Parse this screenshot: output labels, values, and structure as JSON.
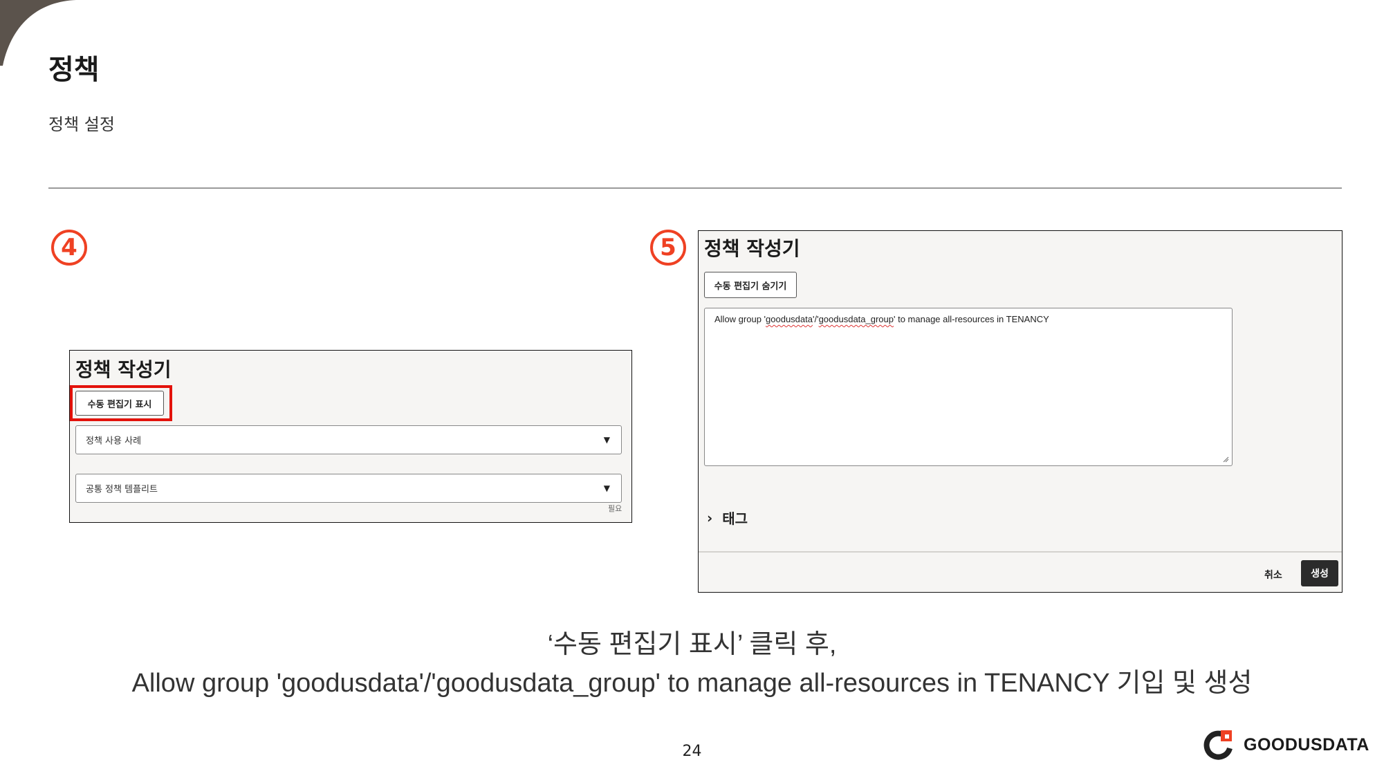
{
  "header": {
    "title": "정책",
    "subtitle": "정책 설정"
  },
  "step4": {
    "badge": "4",
    "panel_title": "정책 작성기",
    "show_editor_button": "수동 편집기 표시",
    "use_case_select": "정책 사용 사례",
    "template_select": "공통 정책 템플리트",
    "required_label": "필요"
  },
  "step5": {
    "badge": "5",
    "panel_title": "정책 작성기",
    "hide_editor_button": "수동 편집기 숨기기",
    "policy_text": {
      "part1": "Allow group '",
      "part2": "goodusdata",
      "part3": "'/'",
      "part4": "goodusdata_group",
      "part5": "' to manage all-resources in TENANCY"
    },
    "tags_label": "태그",
    "cancel_button": "취소",
    "create_button": "생성"
  },
  "caption": {
    "line1": "‘수동 편집기 표시’ 클릭 후,",
    "line2": "Allow group 'goodusdata'/'goodusdata_group' to manage all-resources in TENANCY 기입 및 생성"
  },
  "footer": {
    "page_number": "24",
    "brand": "GOODUSDATA"
  },
  "colors": {
    "accent": "#ef4123",
    "highlight": "#e3120b",
    "corner": "#5b534c",
    "primary_button": "#2b2b2b"
  }
}
